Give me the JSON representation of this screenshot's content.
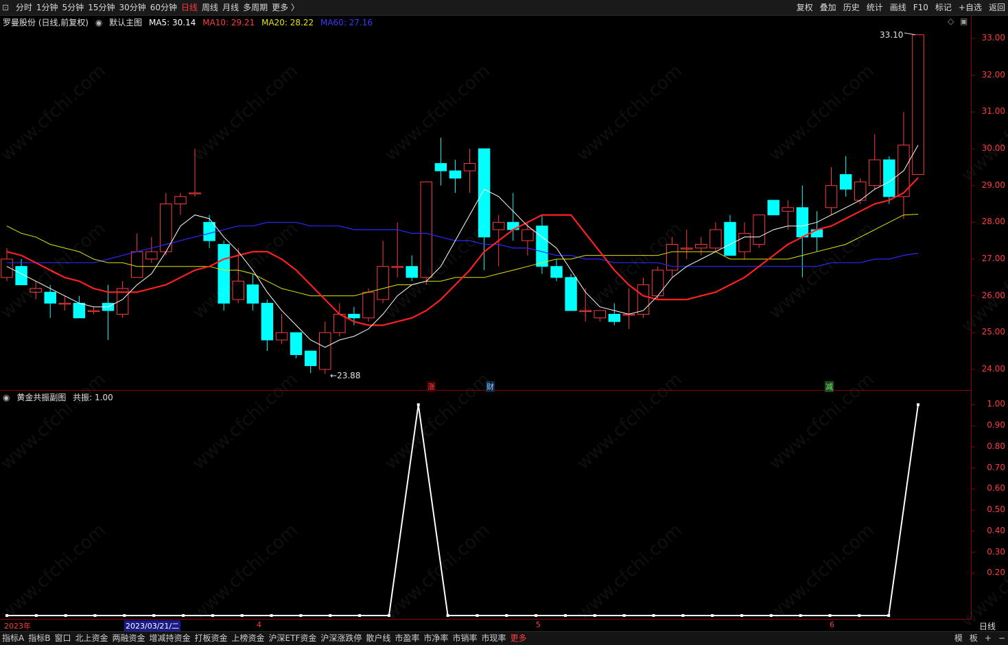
{
  "periods": {
    "icon": "page-icon",
    "items": [
      "分时",
      "1分钟",
      "5分钟",
      "15分钟",
      "30分钟",
      "60分钟",
      "日线",
      "周线",
      "月线",
      "多周期",
      "更多 〉"
    ],
    "active_index": 6
  },
  "right_buttons": [
    "复权",
    "叠加",
    "历史",
    "统计",
    "画线",
    "F10",
    "标记",
    "+自选",
    "返回"
  ],
  "main_chart": {
    "stock": "罗曼股份 (日线,前复权)",
    "template": "默认主图",
    "ma5": "MA5: 30.14",
    "ma10": "MA10: 29.21",
    "ma20": "MA20: 28.22",
    "ma60": "MA60: 27.16",
    "high_label": "33.10",
    "low_label": "23.88",
    "y_ticks": [
      "33.00",
      "32.00",
      "31.00",
      "30.00",
      "29.00",
      "28.00",
      "27.00",
      "26.00",
      "25.00",
      "24.00"
    ],
    "markers": [
      {
        "text": "涨",
        "color": "#ff4040"
      },
      {
        "text": "财",
        "color": "#9ec8ff"
      },
      {
        "text": "减",
        "color": "#4caf50"
      }
    ],
    "colors": {
      "up": "#ff3c3c",
      "down": "#00ffff",
      "ma5": "#ffffff",
      "ma10": "#ff2020",
      "ma20": "#e6e600",
      "ma60": "#2a2aff"
    }
  },
  "sub_chart": {
    "title": "黄金共振副图",
    "value": "共振: 1.00",
    "y_ticks": [
      "1.00",
      "0.90",
      "0.80",
      "0.70",
      "0.60",
      "0.50",
      "0.40",
      "0.30",
      "0.20"
    ]
  },
  "date_axis": {
    "labels": [
      "2023年",
      "2023/03/21/二",
      "4",
      "5",
      "6"
    ],
    "period": "日线"
  },
  "bottom_tabs": {
    "items": [
      "指标A",
      "指标B",
      "窗口",
      "北上资金",
      "两融资金",
      "增减持资金",
      "打板资金",
      "上榜资金",
      "沪深ETF资金",
      "沪深涨跌停",
      "散户线",
      "市盈率",
      "市净率",
      "市销率",
      "市现率",
      "更多"
    ],
    "active_index": 15
  },
  "bottom_right": [
    "模",
    "板",
    "+",
    "−"
  ],
  "watermark": "www.cfchi.com",
  "chart_data": {
    "type": "candlestick",
    "y_range": [
      23.7,
      33.3
    ],
    "candles": [
      {
        "o": 26.5,
        "h": 27.3,
        "l": 26.4,
        "c": 27.0
      },
      {
        "o": 26.8,
        "h": 27.0,
        "l": 26.3,
        "c": 26.3
      },
      {
        "o": 26.1,
        "h": 26.4,
        "l": 25.9,
        "c": 26.2
      },
      {
        "o": 26.1,
        "h": 26.3,
        "l": 25.4,
        "c": 25.8
      },
      {
        "o": 25.8,
        "h": 26.0,
        "l": 25.6,
        "c": 25.8
      },
      {
        "o": 25.8,
        "h": 26.0,
        "l": 25.4,
        "c": 25.4
      },
      {
        "o": 25.6,
        "h": 25.7,
        "l": 25.5,
        "c": 25.6
      },
      {
        "o": 25.8,
        "h": 26.3,
        "l": 24.8,
        "c": 25.6
      },
      {
        "o": 25.5,
        "h": 26.4,
        "l": 25.4,
        "c": 26.2
      },
      {
        "o": 26.5,
        "h": 27.7,
        "l": 26.5,
        "c": 27.2
      },
      {
        "o": 27.0,
        "h": 27.6,
        "l": 26.9,
        "c": 27.2
      },
      {
        "o": 27.2,
        "h": 28.8,
        "l": 27.1,
        "c": 28.5
      },
      {
        "o": 28.5,
        "h": 28.8,
        "l": 28.2,
        "c": 28.7
      },
      {
        "o": 28.8,
        "h": 30.0,
        "l": 28.7,
        "c": 28.8
      },
      {
        "o": 28.0,
        "h": 28.2,
        "l": 27.3,
        "c": 27.5
      },
      {
        "o": 27.4,
        "h": 27.5,
        "l": 25.6,
        "c": 25.8
      },
      {
        "o": 25.9,
        "h": 27.3,
        "l": 25.8,
        "c": 26.4
      },
      {
        "o": 26.3,
        "h": 26.6,
        "l": 25.6,
        "c": 25.8
      },
      {
        "o": 25.8,
        "h": 25.9,
        "l": 24.5,
        "c": 24.8
      },
      {
        "o": 24.8,
        "h": 25.5,
        "l": 24.7,
        "c": 25.0
      },
      {
        "o": 25.0,
        "h": 25.0,
        "l": 24.3,
        "c": 24.4
      },
      {
        "o": 24.5,
        "h": 24.5,
        "l": 23.9,
        "c": 24.1
      },
      {
        "o": 24.0,
        "h": 25.3,
        "l": 23.88,
        "c": 25.0
      },
      {
        "o": 25.0,
        "h": 25.8,
        "l": 24.9,
        "c": 25.5
      },
      {
        "o": 25.5,
        "h": 25.7,
        "l": 25.2,
        "c": 25.4
      },
      {
        "o": 25.4,
        "h": 26.2,
        "l": 25.3,
        "c": 26.1
      },
      {
        "o": 25.9,
        "h": 27.5,
        "l": 25.8,
        "c": 26.8
      },
      {
        "o": 26.8,
        "h": 28.0,
        "l": 26.5,
        "c": 26.8
      },
      {
        "o": 26.8,
        "h": 27.1,
        "l": 26.4,
        "c": 26.5
      },
      {
        "o": 26.5,
        "h": 29.1,
        "l": 26.3,
        "c": 29.1
      },
      {
        "o": 29.6,
        "h": 30.3,
        "l": 29.0,
        "c": 29.4
      },
      {
        "o": 29.4,
        "h": 29.7,
        "l": 28.8,
        "c": 29.2
      },
      {
        "o": 29.4,
        "h": 30.0,
        "l": 28.8,
        "c": 29.6
      },
      {
        "o": 30.0,
        "h": 30.0,
        "l": 26.7,
        "c": 27.6
      },
      {
        "o": 27.8,
        "h": 28.2,
        "l": 26.8,
        "c": 28.0
      },
      {
        "o": 28.0,
        "h": 28.8,
        "l": 27.5,
        "c": 27.8
      },
      {
        "o": 27.5,
        "h": 28.0,
        "l": 27.1,
        "c": 27.8
      },
      {
        "o": 27.9,
        "h": 28.2,
        "l": 26.6,
        "c": 26.8
      },
      {
        "o": 26.8,
        "h": 27.0,
        "l": 26.4,
        "c": 26.5
      },
      {
        "o": 26.5,
        "h": 26.6,
        "l": 25.6,
        "c": 25.6
      },
      {
        "o": 25.6,
        "h": 26.2,
        "l": 25.3,
        "c": 25.6
      },
      {
        "o": 25.4,
        "h": 25.6,
        "l": 25.3,
        "c": 25.6
      },
      {
        "o": 25.5,
        "h": 25.8,
        "l": 25.2,
        "c": 25.3
      },
      {
        "o": 25.5,
        "h": 26.2,
        "l": 25.1,
        "c": 25.5
      },
      {
        "o": 25.5,
        "h": 26.5,
        "l": 25.4,
        "c": 26.3
      },
      {
        "o": 26.0,
        "h": 26.8,
        "l": 25.9,
        "c": 26.7
      },
      {
        "o": 26.7,
        "h": 27.6,
        "l": 26.5,
        "c": 27.4
      },
      {
        "o": 27.3,
        "h": 27.8,
        "l": 27.0,
        "c": 27.3
      },
      {
        "o": 27.3,
        "h": 27.6,
        "l": 27.1,
        "c": 27.4
      },
      {
        "o": 27.3,
        "h": 28.0,
        "l": 27.2,
        "c": 27.8
      },
      {
        "o": 28.0,
        "h": 28.2,
        "l": 27.1,
        "c": 27.1
      },
      {
        "o": 27.2,
        "h": 28.0,
        "l": 27.0,
        "c": 27.7
      },
      {
        "o": 27.4,
        "h": 28.2,
        "l": 27.3,
        "c": 28.2
      },
      {
        "o": 28.6,
        "h": 28.6,
        "l": 28.2,
        "c": 28.2
      },
      {
        "o": 28.3,
        "h": 28.6,
        "l": 27.8,
        "c": 28.4
      },
      {
        "o": 28.4,
        "h": 29.0,
        "l": 26.5,
        "c": 27.6
      },
      {
        "o": 27.8,
        "h": 28.3,
        "l": 27.2,
        "c": 27.6
      },
      {
        "o": 28.4,
        "h": 29.5,
        "l": 28.2,
        "c": 29.0
      },
      {
        "o": 29.3,
        "h": 29.8,
        "l": 28.7,
        "c": 28.9
      },
      {
        "o": 28.6,
        "h": 29.2,
        "l": 28.5,
        "c": 29.1
      },
      {
        "o": 29.0,
        "h": 30.4,
        "l": 28.9,
        "c": 29.7
      },
      {
        "o": 29.7,
        "h": 29.8,
        "l": 28.5,
        "c": 28.7
      },
      {
        "o": 28.7,
        "h": 31.0,
        "l": 28.1,
        "c": 30.1
      },
      {
        "o": 29.3,
        "h": 33.1,
        "l": 29.3,
        "c": 33.1
      }
    ],
    "ma5": [
      26.8,
      26.6,
      26.4,
      26.2,
      26.0,
      25.8,
      25.7,
      25.7,
      25.9,
      26.3,
      26.6,
      27.2,
      27.9,
      28.2,
      28.1,
      27.6,
      27.2,
      26.7,
      26.1,
      25.6,
      25.2,
      24.8,
      24.6,
      24.8,
      24.9,
      25.1,
      25.5,
      26.0,
      26.3,
      26.4,
      26.8,
      27.5,
      28.2,
      28.9,
      28.7,
      28.3,
      27.9,
      27.6,
      27.3,
      26.7,
      26.1,
      25.7,
      25.6,
      25.5,
      25.6,
      26.0,
      26.5,
      26.8,
      27.0,
      27.2,
      27.4,
      27.6,
      27.6,
      27.8,
      27.9,
      27.9,
      28.0,
      28.2,
      28.4,
      28.6,
      28.9,
      29.1,
      29.4,
      30.1
    ],
    "ma10": [
      27.2,
      27.1,
      26.9,
      26.7,
      26.5,
      26.4,
      26.2,
      26.1,
      26.1,
      26.1,
      26.2,
      26.3,
      26.5,
      26.7,
      26.8,
      27.0,
      27.1,
      27.2,
      27.2,
      27.0,
      26.7,
      26.3,
      25.9,
      25.5,
      25.3,
      25.2,
      25.2,
      25.3,
      25.4,
      25.6,
      25.9,
      26.3,
      26.7,
      27.2,
      27.5,
      27.8,
      28.0,
      28.2,
      28.2,
      28.2,
      27.7,
      27.2,
      26.7,
      26.3,
      26.0,
      25.9,
      25.9,
      25.9,
      26.0,
      26.1,
      26.3,
      26.5,
      26.8,
      27.1,
      27.4,
      27.6,
      27.8,
      27.9,
      28.1,
      28.3,
      28.5,
      28.6,
      28.8,
      29.21
    ],
    "ma20": [
      27.9,
      27.7,
      27.6,
      27.4,
      27.3,
      27.2,
      27.0,
      26.9,
      26.9,
      26.8,
      26.8,
      26.8,
      26.8,
      26.8,
      26.8,
      26.7,
      26.7,
      26.6,
      26.4,
      26.2,
      26.1,
      26.0,
      26.0,
      26.0,
      26.0,
      26.1,
      26.2,
      26.3,
      26.3,
      26.4,
      26.4,
      26.5,
      26.5,
      26.5,
      26.6,
      26.7,
      26.8,
      26.9,
      27.0,
      27.0,
      27.1,
      27.1,
      27.1,
      27.1,
      27.1,
      27.1,
      27.2,
      27.2,
      27.2,
      27.2,
      27.0,
      27.0,
      27.0,
      27.0,
      27.0,
      27.1,
      27.2,
      27.3,
      27.4,
      27.6,
      27.8,
      28.0,
      28.2,
      28.22
    ],
    "ma60": [
      26.9,
      26.9,
      26.9,
      26.9,
      26.9,
      26.9,
      26.9,
      27.0,
      27.1,
      27.2,
      27.3,
      27.4,
      27.5,
      27.6,
      27.7,
      27.8,
      27.9,
      27.9,
      28.0,
      28.0,
      28.0,
      27.9,
      27.9,
      27.9,
      27.8,
      27.8,
      27.8,
      27.8,
      27.7,
      27.7,
      27.6,
      27.5,
      27.5,
      27.4,
      27.4,
      27.3,
      27.3,
      27.2,
      27.1,
      27.1,
      27.0,
      27.0,
      26.9,
      26.9,
      26.9,
      26.9,
      26.8,
      26.8,
      26.8,
      26.8,
      26.8,
      26.8,
      26.8,
      26.8,
      26.8,
      26.8,
      26.8,
      26.9,
      26.9,
      26.9,
      27.0,
      27.0,
      27.1,
      27.16
    ],
    "resonance": [
      0,
      0,
      0,
      0,
      0,
      0,
      0,
      0,
      0,
      0,
      0,
      0,
      0,
      0,
      1,
      0,
      0,
      0,
      0,
      0,
      0,
      0,
      0,
      0,
      0,
      0,
      0,
      0,
      0,
      0,
      0,
      1
    ],
    "resonance_y_range": [
      0,
      1.05
    ]
  }
}
